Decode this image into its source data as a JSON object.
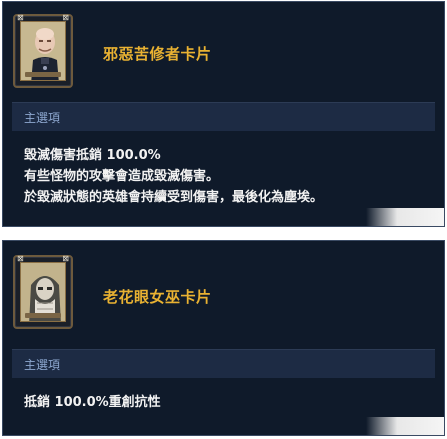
{
  "tooltips": [
    {
      "title": "邪惡苦修者卡片",
      "section_label": "主選項",
      "lines": [
        "毀滅傷害抵銷 100.0%",
        "有些怪物的攻擊會造成毀滅傷害。",
        "於毀滅狀態的英雄會持續受到傷害，最後化為塵埃。"
      ],
      "card_icon": "bald-monk-portrait-icon",
      "card_accent": "#c9b996"
    },
    {
      "title": "老花眼女巫卡片",
      "section_label": "主選項",
      "lines": [
        "抵銷 100.0%重創抗性"
      ],
      "card_icon": "hooded-witch-portrait-icon",
      "card_accent": "#c9b996"
    }
  ],
  "colors": {
    "title": "#e9b232",
    "panel_bg": "#0f1a2a",
    "section_bg": "#1d2b44",
    "section_label": "#8ea8d0",
    "text": "#f2f2f2"
  }
}
